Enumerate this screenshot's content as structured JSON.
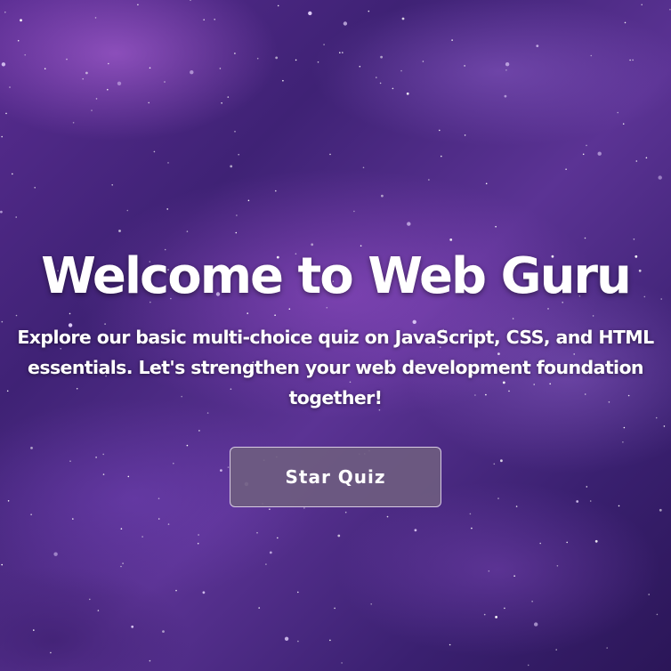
{
  "hero": {
    "title": "Welcome to Web Guru",
    "description": "Explore our basic multi-choice quiz on JavaScript, CSS, and HTML essentials. Let's strengthen your web development foundation together!",
    "start_button_label": "Star Quiz"
  },
  "background": {
    "image": "purple-galaxy-starfield",
    "colors": [
      "#5a2d92",
      "#3f2275",
      "#2b1658"
    ]
  },
  "colors": {
    "text": "#ffffff",
    "button_bg": "#6e5c80",
    "button_border": "#ebe1f5"
  }
}
